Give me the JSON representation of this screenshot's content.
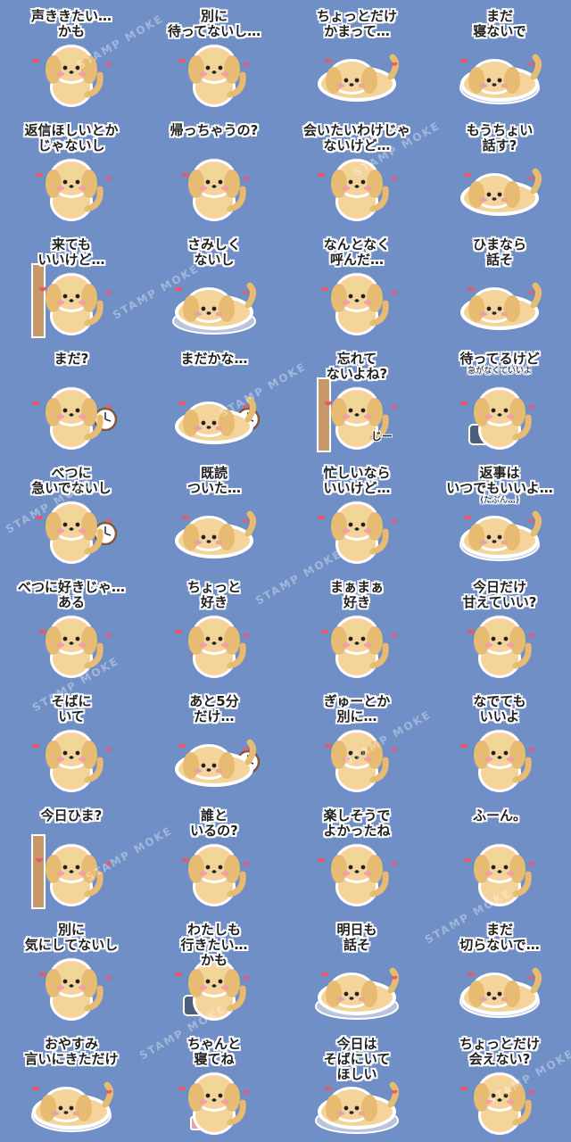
{
  "watermark": "STAMP MOKE",
  "colors": {
    "background": "#6f8fc6",
    "dog_fur": "#f4d49a",
    "dog_fur_dark": "#e8bb72",
    "outline": "#ffffff",
    "heart": "#e85a6a"
  },
  "stickers": [
    {
      "text": "声ききたい…\nかも",
      "prop": "phone"
    },
    {
      "text": "別に\n待ってないし…",
      "prop": "none"
    },
    {
      "text": "ちょっとだけ\nかまって…",
      "prop": "none"
    },
    {
      "text": "まだ\n寝ないで",
      "prop": "blanket"
    },
    {
      "text": "返信ほしいとか\nじゃないし",
      "prop": "phone"
    },
    {
      "text": "帰っちゃうの?",
      "prop": "none"
    },
    {
      "text": "会いたいわけじゃ\nないけど…",
      "prop": "none"
    },
    {
      "text": "もうちょい\n話す?",
      "prop": "none"
    },
    {
      "text": "来ても\nいいけど…",
      "prop": "door"
    },
    {
      "text": "さみしく\nないし",
      "prop": "cushion"
    },
    {
      "text": "なんとなく\n呼んだ…",
      "prop": "none"
    },
    {
      "text": "ひまなら\n話そ",
      "prop": "phone"
    },
    {
      "text": "まだ?",
      "prop": "clock"
    },
    {
      "text": "まだかな…",
      "prop": "clock"
    },
    {
      "text": "忘れて\nないよね?",
      "prop": "door",
      "extra": "じー"
    },
    {
      "text": "待ってるけど",
      "sub": "急がなくていいよ",
      "prop": "bag"
    },
    {
      "text": "べつに\n急いでないし",
      "prop": "clock"
    },
    {
      "text": "既読\nついた…",
      "prop": "phone"
    },
    {
      "text": "忙しいなら\nいいけど…",
      "prop": "none"
    },
    {
      "text": "返事は\nいつでもいいよ…",
      "sub": "(たぶん…)",
      "prop": "blanket"
    },
    {
      "text": "べつに好きじゃ…\nある",
      "prop": "none"
    },
    {
      "text": "ちょっと\n好き",
      "prop": "heart"
    },
    {
      "text": "まぁまぁ\n好き",
      "prop": "none"
    },
    {
      "text": "今日だけ\n甘えていい?",
      "prop": "none"
    },
    {
      "text": "そばに\nいて",
      "prop": "none"
    },
    {
      "text": "あと5分\nだけ…",
      "prop": "clock"
    },
    {
      "text": "ぎゅーとか\n別に…",
      "prop": "none"
    },
    {
      "text": "なでても\nいいよ",
      "prop": "none"
    },
    {
      "text": "今日ひま?",
      "prop": "door"
    },
    {
      "text": "誰と\nいるの?",
      "prop": "phone"
    },
    {
      "text": "楽しそうで\nよかったね",
      "prop": "none"
    },
    {
      "text": "ふーん。",
      "prop": "none"
    },
    {
      "text": "別に\n気にしてないし",
      "prop": "none"
    },
    {
      "text": "わたしも\n行きたい…\nかも",
      "prop": "bag"
    },
    {
      "text": "明日も\n話そ",
      "prop": "cushion"
    },
    {
      "text": "まだ\n切らないで…",
      "prop": "blanket"
    },
    {
      "text": "おやすみ\n言いにきただけ",
      "prop": "blanket"
    },
    {
      "text": "ちゃんと\n寝てね",
      "prop": "cup"
    },
    {
      "text": "今日は\nそばにいて\nほしい",
      "prop": "cushion"
    },
    {
      "text": "ちょっとだけ\n会えない?",
      "prop": "phone"
    }
  ]
}
